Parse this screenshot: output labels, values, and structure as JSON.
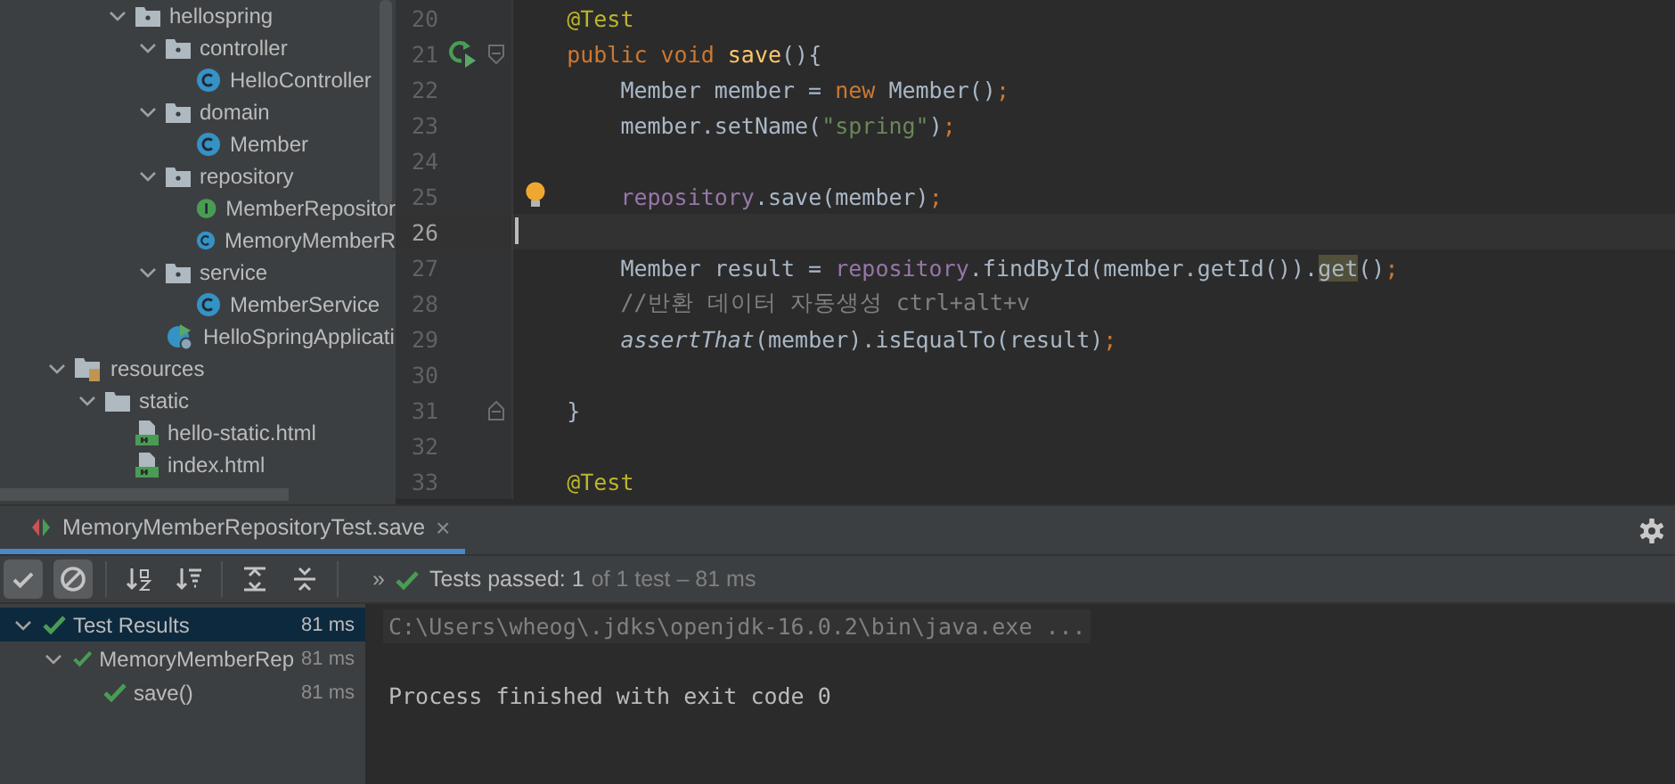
{
  "project_tree": [
    {
      "children": [
        {
          "children": [
            {
              "label": "hellospring",
              "kind": "package",
              "expanded": true,
              "children": [
                {
                  "label": "controller",
                  "kind": "package",
                  "expanded": true,
                  "children": [
                    {
                      "label": "HelloController",
                      "kind": "class"
                    }
                  ]
                },
                {
                  "label": "domain",
                  "kind": "package",
                  "expanded": true,
                  "children": [
                    {
                      "label": "Member",
                      "kind": "class"
                    }
                  ]
                },
                {
                  "label": "repository",
                  "kind": "package",
                  "expanded": true,
                  "children": [
                    {
                      "label": "MemberRepositor",
                      "kind": "interface"
                    },
                    {
                      "label": "MemoryMemberR",
                      "kind": "class"
                    }
                  ]
                },
                {
                  "label": "service",
                  "kind": "package",
                  "expanded": true,
                  "children": [
                    {
                      "label": "MemberService",
                      "kind": "class"
                    }
                  ]
                },
                {
                  "label": "HelloSpringApplicati",
                  "kind": "app"
                }
              ]
            }
          ]
        }
      ]
    },
    {
      "label": "resources",
      "kind": "resources",
      "expanded": true,
      "children": [
        {
          "label": "static",
          "kind": "folder",
          "expanded": true,
          "children": [
            {
              "label": "hello-static.html",
              "kind": "html"
            },
            {
              "label": "index.html",
              "kind": "html"
            }
          ]
        }
      ]
    }
  ],
  "editor": {
    "lines": [
      {
        "number": "20",
        "kind": "member",
        "current": false,
        "tokens": [
          {
            "t": "@Test",
            "kind": "annotation"
          }
        ]
      },
      {
        "number": "21",
        "kind": "member",
        "current": false,
        "gutter_icon": {
          "kind": "run"
        },
        "tokens": [
          {
            "t": "public void ",
            "kind": "keyword"
          },
          {
            "t": "save",
            "kind": "method"
          },
          {
            "t": "(){",
            "kind": "plain"
          }
        ]
      },
      {
        "number": "22",
        "kind": "body",
        "current": false,
        "tokens": [
          {
            "t": "Member member = ",
            "kind": "plain"
          },
          {
            "t": "new ",
            "kind": "keyword"
          },
          {
            "t": "Member()",
            "kind": "plain"
          },
          {
            "t": ";",
            "kind": "keyword"
          }
        ]
      },
      {
        "number": "23",
        "kind": "body",
        "current": false,
        "tokens": [
          {
            "t": "member.setName(",
            "kind": "plain"
          },
          {
            "t": "\"spring\"",
            "kind": "string"
          },
          {
            "t": ")",
            "kind": "plain"
          },
          {
            "t": ";",
            "kind": "keyword"
          }
        ]
      },
      {
        "number": "24",
        "current": false
      },
      {
        "number": "25",
        "kind": "body",
        "current": false,
        "gutter_icon": {
          "kind": "bulb"
        },
        "tokens": [
          {
            "t": "repository",
            "kind": "field"
          },
          {
            "t": ".save(member)",
            "kind": "plain"
          },
          {
            "t": ";",
            "kind": "keyword"
          }
        ]
      },
      {
        "number": "26",
        "current": true
      },
      {
        "number": "27",
        "kind": "body",
        "current": false,
        "tokens": [
          {
            "t": "Member result = ",
            "kind": "plain"
          },
          {
            "t": "repository",
            "kind": "field"
          },
          {
            "t": ".findById(member.getId()).",
            "kind": "plain"
          },
          {
            "t": "get",
            "kind": "highlight"
          },
          {
            "t": "()",
            "kind": "plain"
          },
          {
            "t": ";",
            "kind": "keyword"
          }
        ]
      },
      {
        "number": "28",
        "kind": "body",
        "current": false,
        "tokens": [
          {
            "t": "//반환 데이터 자동생성 ctrl+alt+v",
            "kind": "comment"
          }
        ]
      },
      {
        "number": "29",
        "kind": "body",
        "current": false,
        "tokens": [
          {
            "t": "assertThat",
            "kind": "italic"
          },
          {
            "t": "(member).isEqualTo(result)",
            "kind": "plain"
          },
          {
            "t": ";",
            "kind": "keyword"
          }
        ]
      },
      {
        "number": "30",
        "current": false
      },
      {
        "number": "31",
        "kind": "member",
        "current": false,
        "gutter_icon": {
          "kind": "fold-end"
        },
        "tokens": [
          {
            "t": "}",
            "kind": "plain"
          }
        ]
      },
      {
        "number": "32",
        "current": false
      },
      {
        "number": "33",
        "kind": "member",
        "current": false,
        "tokens": [
          {
            "t": "@Test",
            "kind": "annotation"
          }
        ]
      }
    ]
  },
  "run_panel": {
    "tab": {
      "label": "MemoryMemberRepositoryTest.save",
      "close": "×"
    },
    "toolbar": [
      {
        "kind": "check",
        "selected": true
      },
      {
        "kind": "stop",
        "selected": true
      },
      {
        "kind": "sort-alpha",
        "selected": false
      },
      {
        "kind": "sort-duration",
        "selected": false
      },
      {
        "kind": "expand",
        "selected": false
      },
      {
        "kind": "collapse",
        "selected": false
      }
    ],
    "more": "»",
    "status": {
      "passed": "Tests passed: 1",
      "detail": "of 1 test – 81 ms"
    },
    "results": [
      {
        "label": "Test Results",
        "time": "81 ms",
        "expanded": true,
        "selected": true,
        "children": [
          {
            "label": "MemoryMemberRep",
            "time": "81 ms",
            "expanded": true,
            "selected": false,
            "children": [
              {
                "label": "save()",
                "time": "81 ms",
                "selected": false
              }
            ]
          }
        ]
      }
    ],
    "console": [
      {
        "text": "C:\\Users\\wheog\\.jdks\\openjdk-16.0.2\\bin\\java.exe ...",
        "kind": "command"
      },
      {
        "text": "Process finished with exit code 0",
        "kind": "output"
      }
    ]
  }
}
